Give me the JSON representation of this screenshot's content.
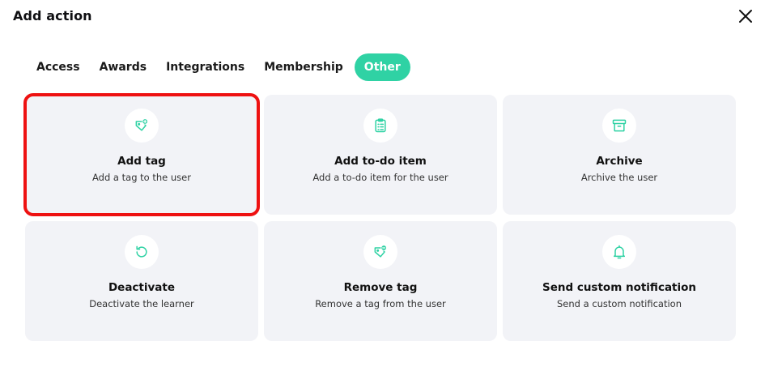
{
  "dialog": {
    "title": "Add action",
    "close_icon": "close-icon"
  },
  "tabs": [
    {
      "label": "Access",
      "active": false
    },
    {
      "label": "Awards",
      "active": false
    },
    {
      "label": "Integrations",
      "active": false
    },
    {
      "label": "Membership",
      "active": false
    },
    {
      "label": "Other",
      "active": true
    }
  ],
  "accent_color": "#2fd2a4",
  "highlight_color": "#ee1111",
  "actions": [
    {
      "title": "Add tag",
      "description": "Add a tag to the user",
      "icon": "tag-add-icon",
      "selected": true
    },
    {
      "title": "Add to-do item",
      "description": "Add a to-do item for the user",
      "icon": "clipboard-list-icon",
      "selected": false
    },
    {
      "title": "Archive",
      "description": "Archive the user",
      "icon": "archive-box-icon",
      "selected": false
    },
    {
      "title": "Deactivate",
      "description": "Deactivate the learner",
      "icon": "undo-icon",
      "selected": false
    },
    {
      "title": "Remove tag",
      "description": "Remove a tag from the user",
      "icon": "tag-remove-icon",
      "selected": false
    },
    {
      "title": "Send custom notification",
      "description": "Send a custom notification",
      "icon": "bell-icon",
      "selected": false
    }
  ]
}
